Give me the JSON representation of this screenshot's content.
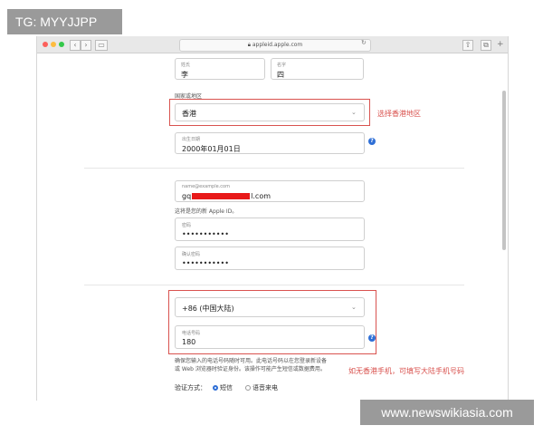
{
  "watermarks": {
    "top_left": "TG: MYYJJPP",
    "bottom_right": "www.newswikiasia.com"
  },
  "browser": {
    "url": "appleid.apple.com",
    "back": "‹",
    "forward": "›"
  },
  "form": {
    "last_name": {
      "label": "姓氏",
      "value": "李"
    },
    "first_name": {
      "label": "名字",
      "value": "四"
    },
    "region": {
      "label": "国家或地区",
      "value": "香港",
      "annotation": "选择香港地区"
    },
    "birthday": {
      "label": "出生日期",
      "value": "2000年01月01日"
    },
    "email": {
      "label": "name@example.com",
      "value_prefix": "gq",
      "value_suffix": "l.com",
      "hint": "这将是您的新 Apple ID。"
    },
    "password": {
      "label": "密码",
      "value": "•••••••••••"
    },
    "confirm_password": {
      "label": "确认密码",
      "value": "•••••••••••"
    },
    "phone_country": {
      "value": "+86 (中国大陆)"
    },
    "phone": {
      "label": "电话号码",
      "value": "180",
      "annotation": "如无香港手机，可填写大陆手机号码"
    },
    "phone_note_1": "确保您输入的电话号码随时可用。此电话号码以在您登录新设备",
    "phone_note_2": "或 Web 浏览器时验证身份。该操作可能产生短信或数据费用。",
    "verify_label": "验证方式：",
    "verify_sms": "短信",
    "verify_call": "语音来电"
  },
  "colors": {
    "accent": "#2f6fd6",
    "annotation": "#d9534f"
  }
}
